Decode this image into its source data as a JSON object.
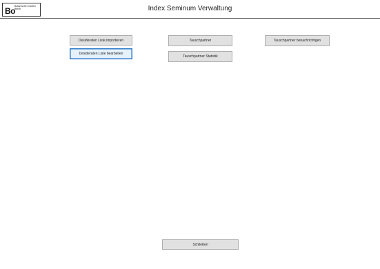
{
  "header": {
    "logo": {
      "mark": "Bo",
      "line1": "Botanischer Garten",
      "line2": "Berlin"
    },
    "title": "Index Seminum Verwaltung"
  },
  "actions": {
    "import_label": "Desideraten Liste importieren",
    "edit_label": "Desideraten Liste bearbeiten",
    "partner_label": "Tauschpartner",
    "stats_label": "Tauschpartner Statistik",
    "notify_label": "Tauschpartner benachrichtigen"
  },
  "footer": {
    "close_label": "Schließen"
  },
  "colors": {
    "button_face": "#e1e1e1",
    "button_border": "#adadad",
    "focus_border": "#2a79c9",
    "header_rule": "#555555"
  }
}
